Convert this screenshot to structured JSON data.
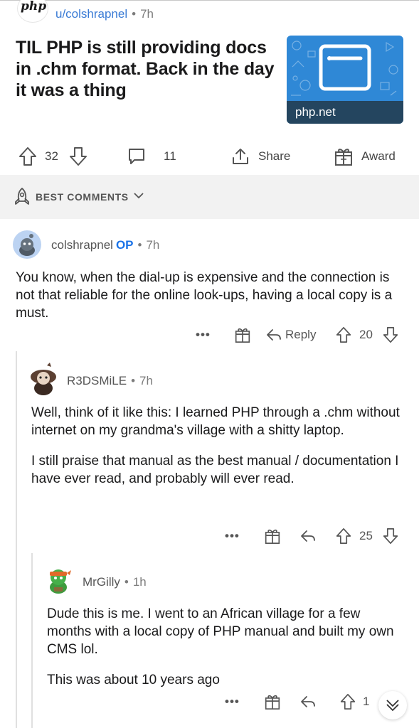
{
  "post": {
    "subreddit_logo_text": "php",
    "author": "u/colshrapnel",
    "separator": "•",
    "time": "7h",
    "title": "TIL PHP is still providing docs in .chm format. Back in the day it was a thing",
    "link_domain": "php.net",
    "upvotes": "32",
    "comments": "11",
    "share_label": "Share",
    "award_label": "Award"
  },
  "best_comments": {
    "label": "BEST COMMENTS"
  },
  "comments": [
    {
      "author": "colshrapnel",
      "op_badge": "OP",
      "separator": "•",
      "time": "7h",
      "paragraphs": [
        "You know, when the dial-up is expensive and the connection is not that reliable for the online look-ups, having a local copy is a must."
      ],
      "more": "•••",
      "reply_label": "Reply",
      "score": "20"
    },
    {
      "author": "R3DSMiLE",
      "separator": "•",
      "time": "7h",
      "paragraphs": [
        "Well, think of it like this: I learned PHP through a .chm without internet on my grandma's village with a shitty laptop.",
        "I still praise that manual as the best manual / documentation I have ever read, and probably will ever read."
      ],
      "more": "•••",
      "score": "25"
    },
    {
      "author": "MrGilly",
      "separator": "•",
      "time": "1h",
      "paragraphs": [
        "Dude this is me. I went to an African village for a few months with a local copy of PHP manual and built my own CMS lol.",
        "This was about 10 years ago"
      ],
      "more": "•••",
      "score": "1"
    }
  ],
  "colors": {
    "link_blue": "#3a7bd5",
    "op_blue": "#1a73e8",
    "thumb_blue": "#2f88d6",
    "thumb_bar": "#24455f",
    "best_bar_bg": "#f2f2f2"
  }
}
